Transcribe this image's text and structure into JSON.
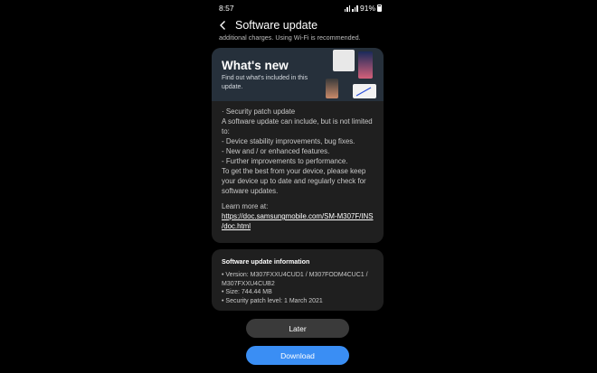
{
  "status_bar": {
    "time": "8:57",
    "battery": "91%"
  },
  "app_bar": {
    "title": "Software update"
  },
  "clipped_notice": "additional charges. Using Wi-Fi is recommended.",
  "whats_new": {
    "title": "What's new",
    "subtitle_line1": "Find out what's included in this",
    "subtitle_line2": "update."
  },
  "changelog": {
    "lines": [
      "· Security patch update",
      "A software update can include, but is not limited",
      "to:",
      " - Device stability improvements, bug fixes.",
      " - New and / or enhanced features.",
      " - Further improvements to performance.",
      "To get the best from your device, please keep",
      "your device up to date and regularly check for",
      "software updates."
    ],
    "learn_more": "Learn more at:",
    "link_line1": "https://doc.samsungmobile.com/SM-M307F/INS",
    "link_line2": "/doc.html"
  },
  "info": {
    "title": "Software update information",
    "lines": [
      "• Version: M307FXXU4CUD1 / M307FODM4CUC1 /",
      "   M307FXXU4CUB2",
      "• Size: 744.44 MB",
      "• Security patch level: 1 March 2021"
    ]
  },
  "buttons": {
    "later": "Later",
    "download": "Download"
  },
  "colors": {
    "accent": "#3a8ef4",
    "card": "#1f1f1f",
    "banner": "#26303b"
  }
}
